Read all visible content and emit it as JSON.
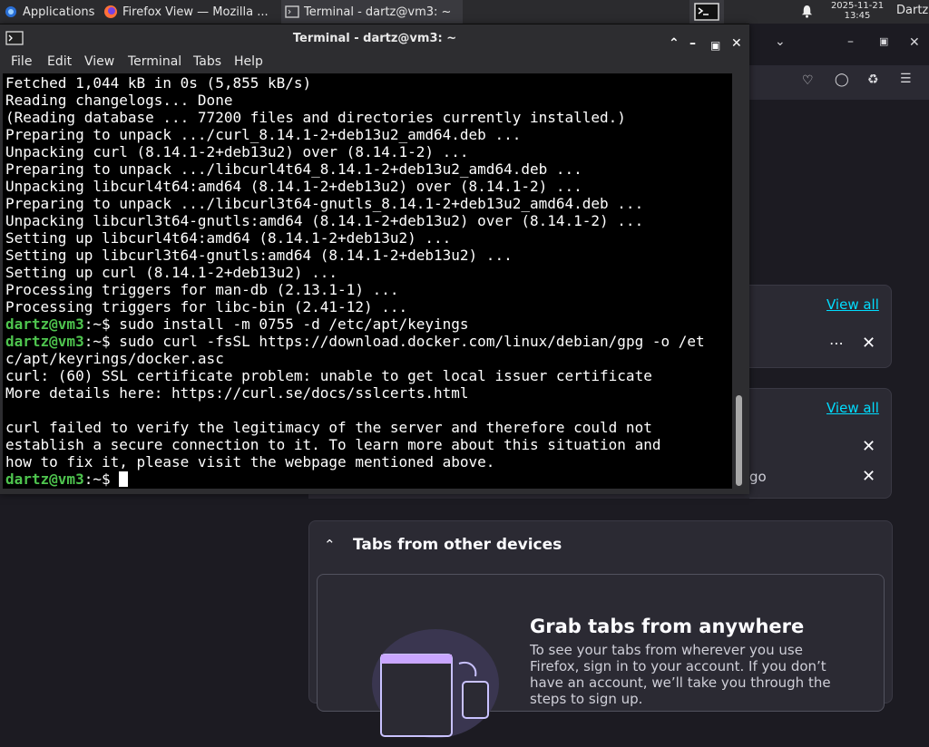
{
  "panel": {
    "applications_label": "Applications",
    "tasks": [
      {
        "label": "Firefox View — Mozilla ..."
      },
      {
        "label": "Terminal - dartz@vm3: ~"
      }
    ],
    "clock_date": "2025-11-21",
    "clock_time": "13:45",
    "user": "Dartz"
  },
  "terminal": {
    "title": "Terminal - dartz@vm3: ~",
    "menu": [
      "File",
      "Edit",
      "View",
      "Terminal",
      "Tabs",
      "Help"
    ],
    "prompt": "dartz@vm3",
    "prompt_suffix": ":~$ ",
    "lines": [
      {
        "type": "out",
        "text": "Fetched 1,044 kB in 0s (5,855 kB/s)"
      },
      {
        "type": "out",
        "text": "Reading changelogs... Done"
      },
      {
        "type": "out",
        "text": "(Reading database ... 77200 files and directories currently installed.)"
      },
      {
        "type": "out",
        "text": "Preparing to unpack .../curl_8.14.1-2+deb13u2_amd64.deb ..."
      },
      {
        "type": "out",
        "text": "Unpacking curl (8.14.1-2+deb13u2) over (8.14.1-2) ..."
      },
      {
        "type": "out",
        "text": "Preparing to unpack .../libcurl4t64_8.14.1-2+deb13u2_amd64.deb ..."
      },
      {
        "type": "out",
        "text": "Unpacking libcurl4t64:amd64 (8.14.1-2+deb13u2) over (8.14.1-2) ..."
      },
      {
        "type": "out",
        "text": "Preparing to unpack .../libcurl3t64-gnutls_8.14.1-2+deb13u2_amd64.deb ..."
      },
      {
        "type": "out",
        "text": "Unpacking libcurl3t64-gnutls:amd64 (8.14.1-2+deb13u2) over (8.14.1-2) ..."
      },
      {
        "type": "out",
        "text": "Setting up libcurl4t64:amd64 (8.14.1-2+deb13u2) ..."
      },
      {
        "type": "out",
        "text": "Setting up libcurl3t64-gnutls:amd64 (8.14.1-2+deb13u2) ..."
      },
      {
        "type": "out",
        "text": "Setting up curl (8.14.1-2+deb13u2) ..."
      },
      {
        "type": "out",
        "text": "Processing triggers for man-db (2.13.1-1) ..."
      },
      {
        "type": "out",
        "text": "Processing triggers for libc-bin (2.41-12) ..."
      },
      {
        "type": "cmd",
        "text": "sudo install -m 0755 -d /etc/apt/keyings"
      },
      {
        "type": "cmd",
        "text": "sudo curl -fsSL https://download.docker.com/linux/debian/gpg -o /et"
      },
      {
        "type": "out",
        "text": "c/apt/keyrings/docker.asc"
      },
      {
        "type": "out",
        "text": "curl: (60) SSL certificate problem: unable to get local issuer certificate"
      },
      {
        "type": "out",
        "text": "More details here: https://curl.se/docs/sslcerts.html"
      },
      {
        "type": "out",
        "text": ""
      },
      {
        "type": "out",
        "text": "curl failed to verify the legitimacy of the server and therefore could not"
      },
      {
        "type": "out",
        "text": "establish a secure connection to it. To learn more about this situation and"
      },
      {
        "type": "out",
        "text": "how to fix it, please visit the webpage mentioned above."
      },
      {
        "type": "cmd",
        "text": ""
      }
    ]
  },
  "firefox": {
    "view_all_1": "View all",
    "view_all_2": "View all",
    "partial_text": "go",
    "tabs_section_title": "Tabs from other devices",
    "grab_title": "Grab tabs from anywhere",
    "grab_text": "To see your tabs from wherever you use Firefox, sign in to your account. If you don’t have an account, we’ll take you through the steps to sign up."
  }
}
